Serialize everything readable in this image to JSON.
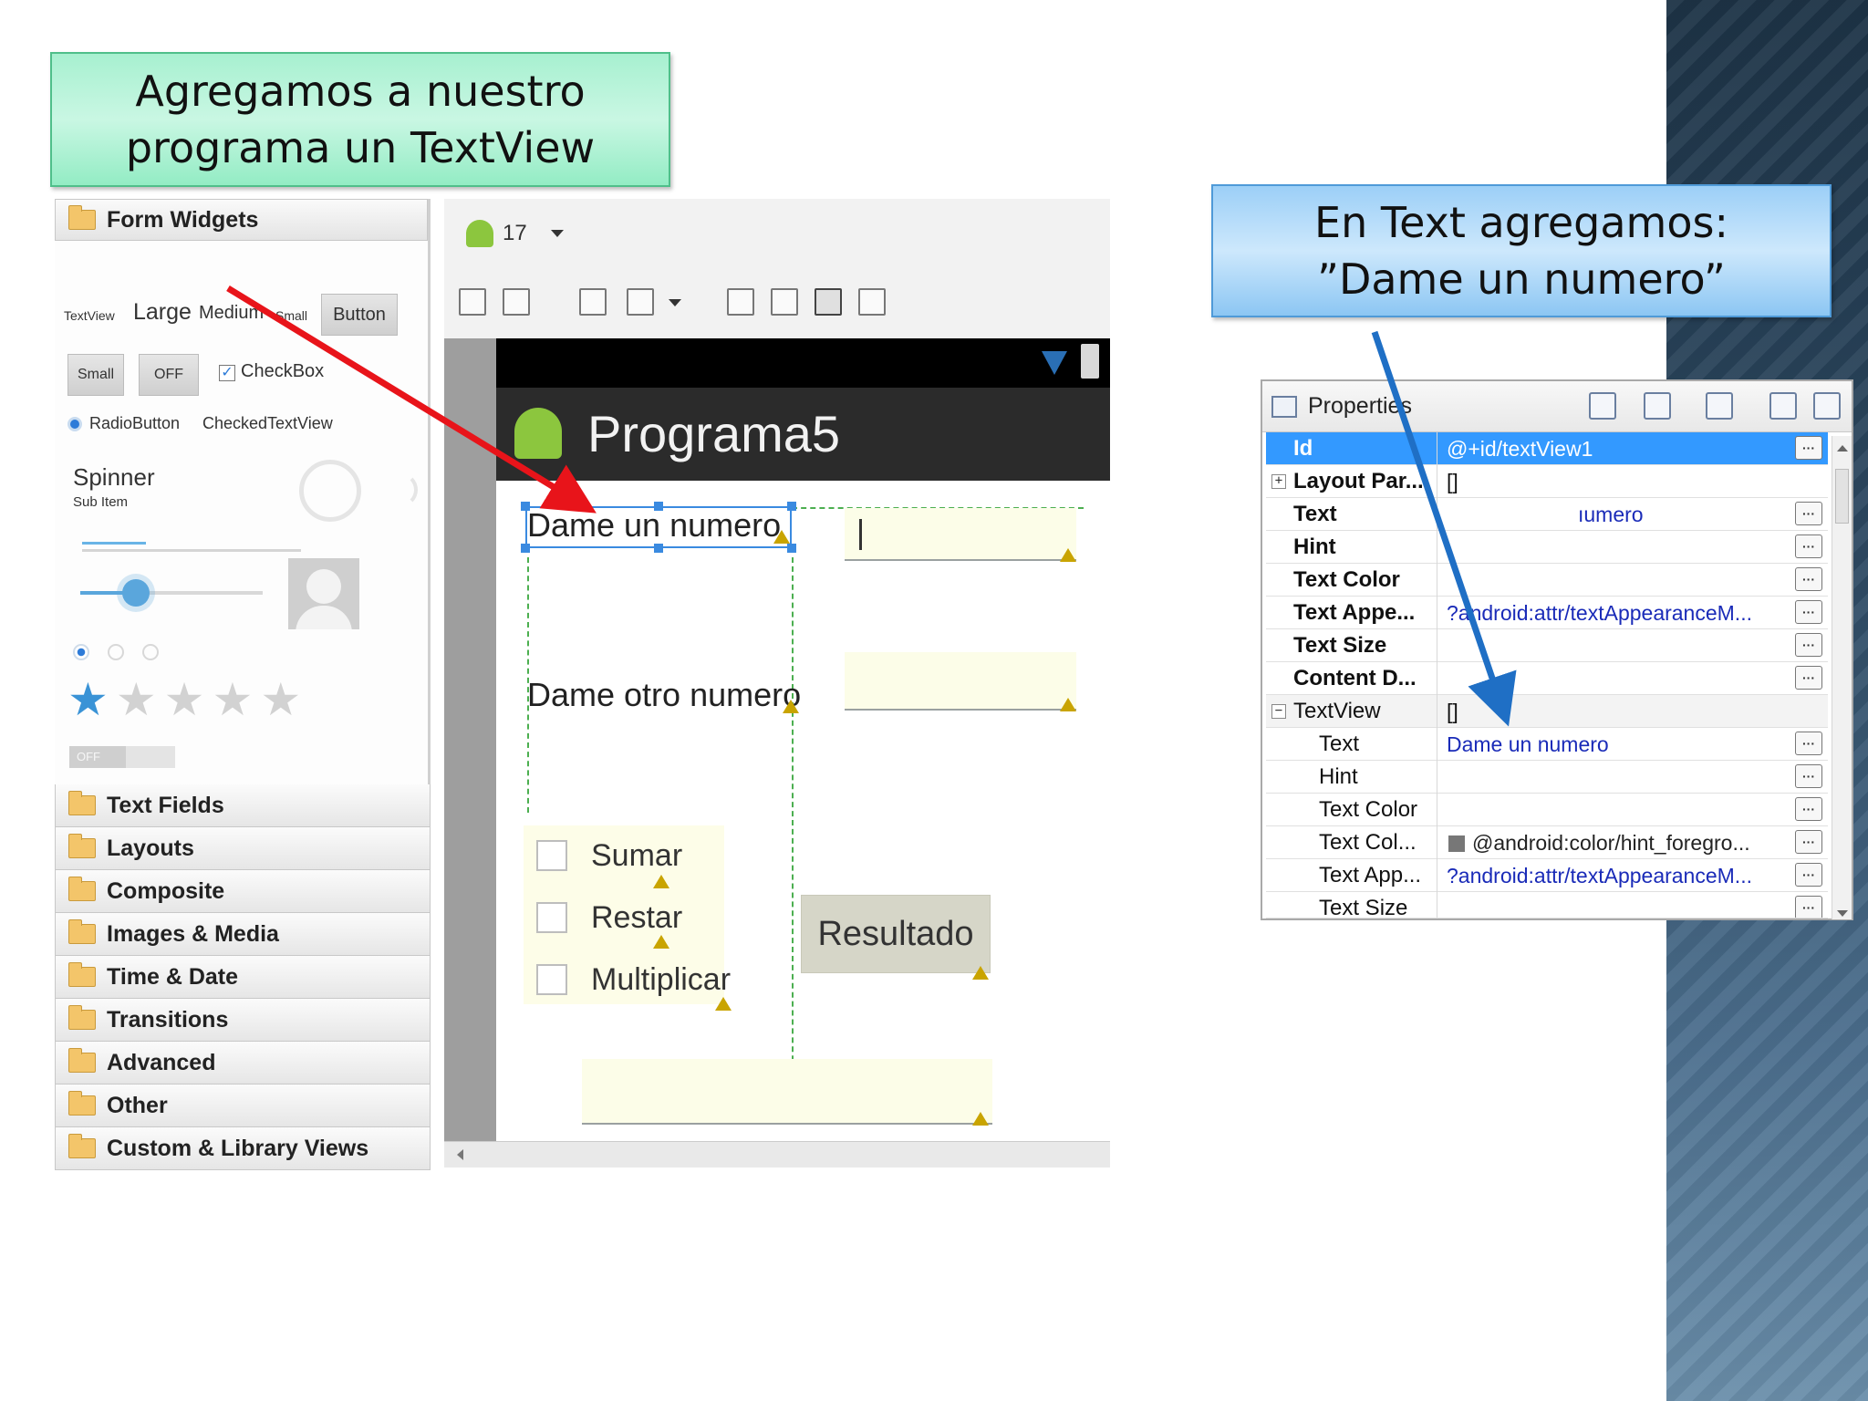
{
  "callouts": {
    "left_line1": "Agregamos a nuestro",
    "left_line2": "programa un TextView",
    "right_line1": "En Text agregamos:",
    "right_line2": "”Dame un numero”"
  },
  "palette": {
    "form_widgets_label": "Form Widgets",
    "widgets": {
      "textview": "TextView",
      "large": "Large",
      "medium": "Medium",
      "small": "Small",
      "button": "Button",
      "small_button": "Small",
      "toggle_off": "OFF",
      "checkbox": "CheckBox",
      "radiobutton": "RadioButton",
      "checkedtextview": "CheckedTextView",
      "spinner": "Spinner",
      "spinner_sub": "Sub Item",
      "switch_off": "OFF"
    },
    "categories": [
      {
        "label": "Text Fields"
      },
      {
        "label": "Layouts"
      },
      {
        "label": "Composite"
      },
      {
        "label": "Images & Media"
      },
      {
        "label": "Time & Date"
      },
      {
        "label": "Transitions"
      },
      {
        "label": "Advanced"
      },
      {
        "label": "Other"
      },
      {
        "label": "Custom & Library Views"
      }
    ]
  },
  "designer": {
    "api_level": "17",
    "app_title": "Programa5",
    "label1": "Dame un numero",
    "label2": "Dame otro numero",
    "check_sumar": "Sumar",
    "check_restar": "Restar",
    "check_multiplicar": "Multiplicar",
    "button_resultado": "Resultado"
  },
  "properties": {
    "title": "Properties",
    "more_glyph": "···",
    "rows": [
      {
        "name": "Id",
        "value": "@+id/textView1",
        "selected": true
      },
      {
        "name": "Layout Par...",
        "value": "[]"
      },
      {
        "name": "Text",
        "value": "ıumero"
      },
      {
        "name": "Hint",
        "value": ""
      },
      {
        "name": "Text Color",
        "value": ""
      },
      {
        "name": "Text Appe...",
        "value": "?android:attr/textAppearanceM..."
      },
      {
        "name": "Text Size",
        "value": ""
      },
      {
        "name": "Content D...",
        "value": ""
      },
      {
        "name": "TextView",
        "value": "[]"
      },
      {
        "name": "Text",
        "value": "Dame un numero"
      },
      {
        "name": "Hint",
        "value": ""
      },
      {
        "name": "Text Color",
        "value": ""
      },
      {
        "name": "Text Col...",
        "value": "@android:color/hint_foregro..."
      },
      {
        "name": "Text App...",
        "value": "?android:attr/textAppearanceM..."
      },
      {
        "name": "Text Size",
        "value": ""
      }
    ]
  },
  "colors": {
    "red_arrow": "#e8141a",
    "blue_arrow": "#1f6fc5",
    "selection_blue": "#3399ff"
  }
}
